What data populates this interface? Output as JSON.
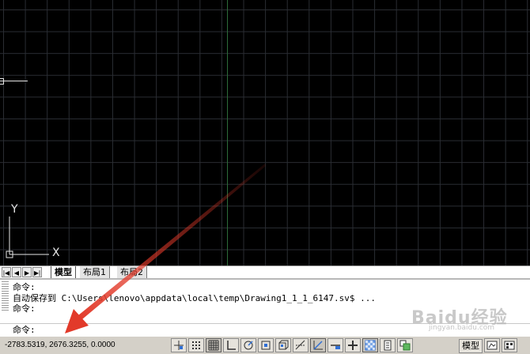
{
  "canvas": {
    "ucs": {
      "y_label": "Y",
      "x_label": "X"
    }
  },
  "tabs": {
    "nav_first": "|◀",
    "nav_prev": "◀",
    "nav_next": "▶",
    "nav_last": "▶|",
    "items": [
      {
        "label": "模型",
        "active": true
      },
      {
        "label": "布局1",
        "active": false
      },
      {
        "label": "布局2",
        "active": false
      }
    ]
  },
  "command_window": {
    "history": [
      "命令:",
      "自动保存到 C:\\Users\\lenovo\\appdata\\local\\temp\\Drawing1_1_1_6147.sv$ ...",
      "命令:"
    ],
    "prompt": "命令:",
    "input_value": ""
  },
  "status_bar": {
    "coordinates": "-2783.5319, 2676.3255, 0.0000",
    "toggles": [
      {
        "icon": "infer-constraints-icon",
        "on": false
      },
      {
        "icon": "snap-mode-icon",
        "on": false
      },
      {
        "icon": "grid-display-icon",
        "on": true
      },
      {
        "icon": "ortho-mode-icon",
        "on": false
      },
      {
        "icon": "polar-tracking-icon",
        "on": false
      },
      {
        "icon": "object-snap-icon",
        "on": false
      },
      {
        "icon": "3d-object-snap-icon",
        "on": false
      },
      {
        "icon": "object-snap-tracking-icon",
        "on": false
      },
      {
        "icon": "dynamic-ucs-icon",
        "on": true
      },
      {
        "icon": "dynamic-input-icon",
        "on": false
      },
      {
        "icon": "lineweight-icon",
        "on": false
      },
      {
        "icon": "transparency-icon",
        "on": true
      },
      {
        "icon": "quick-properties-icon",
        "on": false
      },
      {
        "icon": "selection-cycling-icon",
        "on": false
      }
    ],
    "model_label": "模型",
    "colors": {
      "accent_blue": "#2f6fd6",
      "arrow_red": "#e23a2a"
    }
  },
  "watermark": {
    "main": "Baidu经验",
    "sub": "jingyan.baidu.com"
  }
}
